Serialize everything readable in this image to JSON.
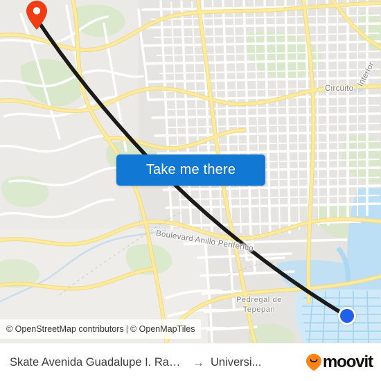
{
  "map": {
    "labels": {
      "periferico": "Boulevard Anillo Periférico",
      "circuito": "Circuito",
      "interior": "Interior",
      "pedregal_line1": "Pedregal de",
      "pedregal_line2": "Tepepan"
    },
    "origin_marker_name": "origin-pin",
    "destination_marker_name": "destination-dot",
    "colors": {
      "land": "#eceae6",
      "road_minor": "#ffffff",
      "road_arterial": "#f7e08a",
      "road_arterial_casing": "#f0d878",
      "park": "#d4e8c3",
      "water": "#b8dcf2",
      "route_line": "#1a1a1a",
      "origin_pin": "#f03c12",
      "destination_dot": "#2160e8",
      "button_blue": "#1178d3",
      "moovit_orange": "#ff8414"
    }
  },
  "attribution": {
    "osm": "© OpenStreetMap contributors",
    "separator": "|",
    "tiles": "© OpenMapTiles"
  },
  "button": {
    "take_me_there_label": "Take me there"
  },
  "bottom_bar": {
    "origin": "Skate Avenida Guadalupe I. Ramírez Tie...",
    "arrow": "→",
    "destination": "Universi...",
    "brand": "moovit"
  }
}
